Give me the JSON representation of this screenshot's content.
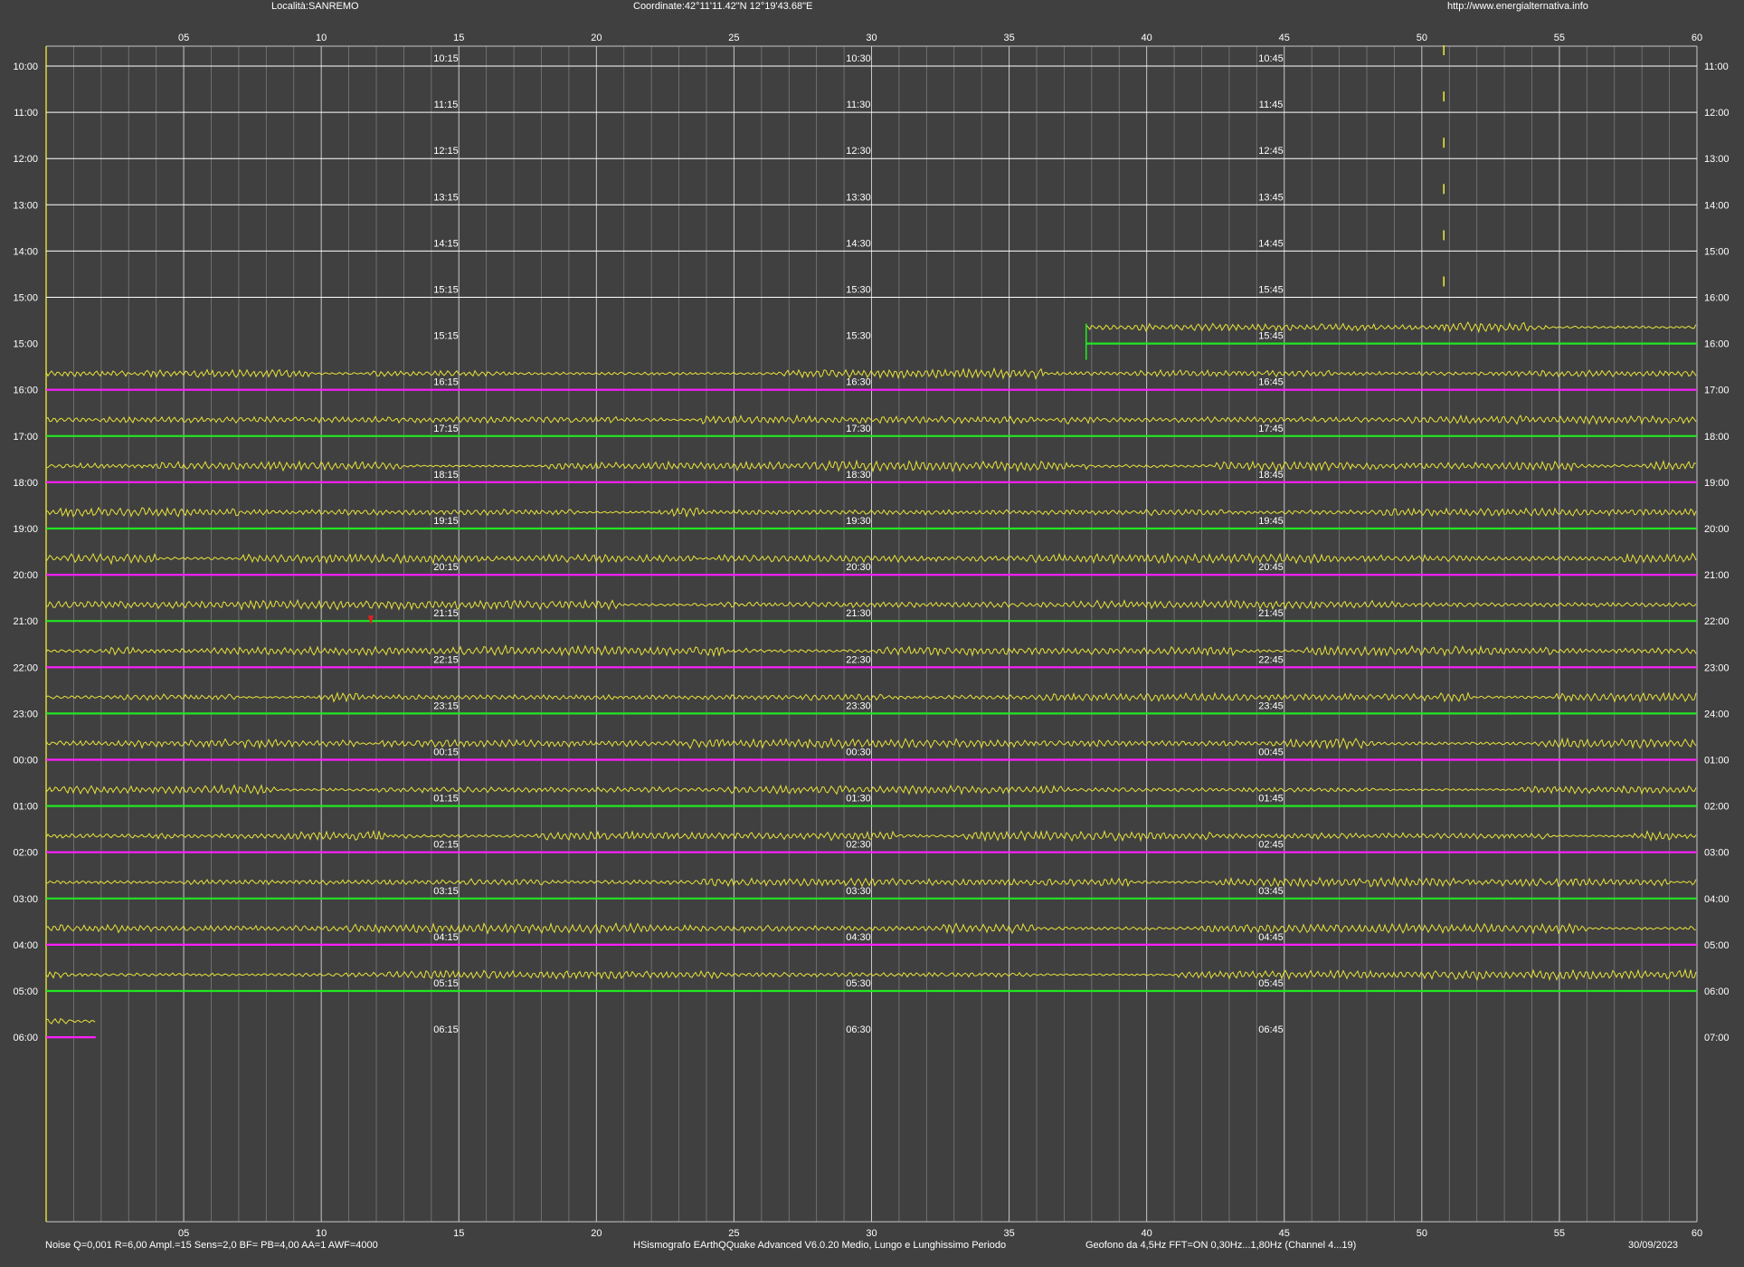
{
  "header": {
    "location": "Località:SANREMO",
    "coordinates": "Coordinate:42°11'11.42\"N  12°19'43.68\"E",
    "website": "http://www.energialternativa.info"
  },
  "footer": {
    "parameters": "Noise Q=0,001 R=6,00 Ampl.=15 Sens=2,0 BF= PB=4,00 AA=1 AWF=4000",
    "software": "HSismografo  EArthQQuake Advanced V6.0.20  Medio, Lungo e Lunghissimo Periodo",
    "sensor": "Geofono da 4,5Hz FFT=ON 0,30Hz...1,80Hz      (Channel 4...19)",
    "date": "30/09/2023"
  },
  "colors": {
    "background": "#404040",
    "trace": "#e8e23a",
    "green_line": "#22e622",
    "magenta_line": "#ff1eff",
    "grid_major": "#c8c8c8",
    "grid_minor": "#7a7a7a",
    "text": "#ffffff",
    "event_marker": "#e02020"
  },
  "chart_data": {
    "type": "line",
    "x_axis_minutes": {
      "min": 0,
      "max": 60,
      "tick_labels": [
        "05",
        "10",
        "15",
        "20",
        "25",
        "30",
        "35",
        "40",
        "45",
        "50",
        "55",
        "60"
      ],
      "tick_values": [
        5,
        10,
        15,
        20,
        25,
        30,
        35,
        40,
        45,
        50,
        55,
        60
      ]
    },
    "rows": [
      {
        "left": "10:00",
        "right": "11:00",
        "q1": "10:15",
        "q2": "10:30",
        "q3": "10:45",
        "trace": "none",
        "line": "white",
        "tick_marks_at_min": 50.8
      },
      {
        "left": "11:00",
        "right": "12:00",
        "q1": "11:15",
        "q2": "11:30",
        "q3": "11:45",
        "trace": "none",
        "line": "white",
        "tick_marks_at_min": 50.8
      },
      {
        "left": "12:00",
        "right": "13:00",
        "q1": "12:15",
        "q2": "12:30",
        "q3": "12:45",
        "trace": "none",
        "line": "white",
        "tick_marks_at_min": 50.8
      },
      {
        "left": "13:00",
        "right": "14:00",
        "q1": "13:15",
        "q2": "13:30",
        "q3": "13:45",
        "trace": "none",
        "line": "white",
        "tick_marks_at_min": 50.8
      },
      {
        "left": "14:00",
        "right": "15:00",
        "q1": "14:15",
        "q2": "14:30",
        "q3": "14:45",
        "trace": "none",
        "line": "white",
        "tick_marks_at_min": 50.8
      },
      {
        "left": "15:00",
        "right": "16:00",
        "q1": "15:15",
        "q2": "15:30",
        "q3": "15:45",
        "trace": "none",
        "line": "white",
        "tick_marks_at_min": 50.8
      },
      {
        "left": "15:00",
        "right": "16:00",
        "q1": "15:15",
        "q2": "15:30",
        "q3": "15:45",
        "trace": "partial",
        "line": "green",
        "trace_start_min": 37.8,
        "trace_end_min": 60
      },
      {
        "left": "16:00",
        "right": "17:00",
        "q1": "16:15",
        "q2": "16:30",
        "q3": "16:45",
        "trace": "full",
        "line": "magenta"
      },
      {
        "left": "17:00",
        "right": "18:00",
        "q1": "17:15",
        "q2": "17:30",
        "q3": "17:45",
        "trace": "full",
        "line": "green"
      },
      {
        "left": "18:00",
        "right": "19:00",
        "q1": "18:15",
        "q2": "18:30",
        "q3": "18:45",
        "trace": "full",
        "line": "magenta"
      },
      {
        "left": "19:00",
        "right": "20:00",
        "q1": "19:15",
        "q2": "19:30",
        "q3": "19:45",
        "trace": "full",
        "line": "green"
      },
      {
        "left": "20:00",
        "right": "21:00",
        "q1": "20:15",
        "q2": "20:30",
        "q3": "20:45",
        "trace": "full",
        "line": "magenta"
      },
      {
        "left": "21:00",
        "right": "22:00",
        "q1": "21:15",
        "q2": "21:30",
        "q3": "21:45",
        "trace": "full",
        "line": "green",
        "event_at_min": 11.8
      },
      {
        "left": "22:00",
        "right": "23:00",
        "q1": "22:15",
        "q2": "22:30",
        "q3": "22:45",
        "trace": "full",
        "line": "magenta"
      },
      {
        "left": "23:00",
        "right": "24:00",
        "q1": "23:15",
        "q2": "23:30",
        "q3": "23:45",
        "trace": "full",
        "line": "green"
      },
      {
        "left": "00:00",
        "right": "01:00",
        "q1": "00:15",
        "q2": "00:30",
        "q3": "00:45",
        "trace": "full",
        "line": "magenta"
      },
      {
        "left": "01:00",
        "right": "02:00",
        "q1": "01:15",
        "q2": "01:30",
        "q3": "01:45",
        "trace": "full",
        "line": "green"
      },
      {
        "left": "02:00",
        "right": "03:00",
        "q1": "02:15",
        "q2": "02:30",
        "q3": "02:45",
        "trace": "full",
        "line": "magenta"
      },
      {
        "left": "03:00",
        "right": "04:00",
        "q1": "03:15",
        "q2": "03:30",
        "q3": "03:45",
        "trace": "full",
        "line": "green"
      },
      {
        "left": "04:00",
        "right": "05:00",
        "q1": "04:15",
        "q2": "04:30",
        "q3": "04:45",
        "trace": "full",
        "line": "magenta"
      },
      {
        "left": "05:00",
        "right": "06:00",
        "q1": "05:15",
        "q2": "05:30",
        "q3": "05:45",
        "trace": "full",
        "line": "green"
      },
      {
        "left": "06:00",
        "right": "07:00",
        "q1": "06:15",
        "q2": "06:30",
        "q3": "06:45",
        "trace": "partial",
        "line": "magenta",
        "trace_start_min": 0,
        "trace_end_min": 1.8
      }
    ]
  }
}
